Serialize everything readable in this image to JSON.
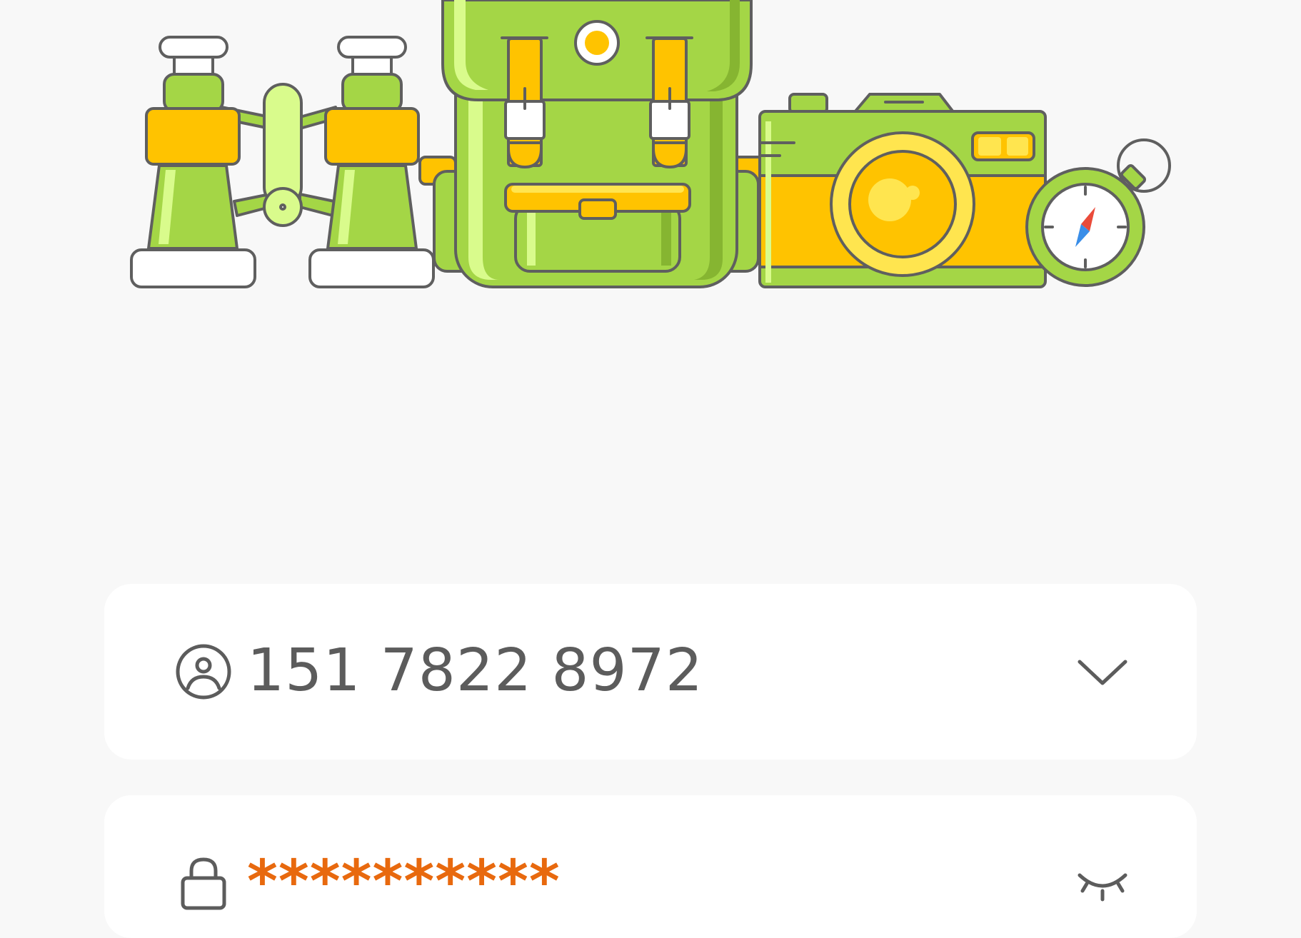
{
  "login_form": {
    "account": {
      "icon": "user-circle-icon",
      "value": "151 7822 8972",
      "dropdown_icon": "chevron-down-icon"
    },
    "password": {
      "icon": "lock-icon",
      "value": "**********",
      "toggle_icon": "eye-closed-icon"
    }
  },
  "hero_illustration": {
    "items": [
      "binoculars",
      "backpack",
      "camera",
      "compass"
    ],
    "colors": {
      "green": "#a4d646",
      "dark_green": "#86b531",
      "light_green": "#d9fb8c",
      "yellow": "#ffc300",
      "light_yellow": "#ffe54f",
      "outline": "#5f5f5f",
      "compass_red": "#ea4b3a",
      "compass_blue": "#3a8ee8"
    }
  },
  "colors": {
    "background": "#f8f8f8",
    "card": "#ffffff",
    "text": "#5c5c5c",
    "password_text": "#e8690e"
  }
}
